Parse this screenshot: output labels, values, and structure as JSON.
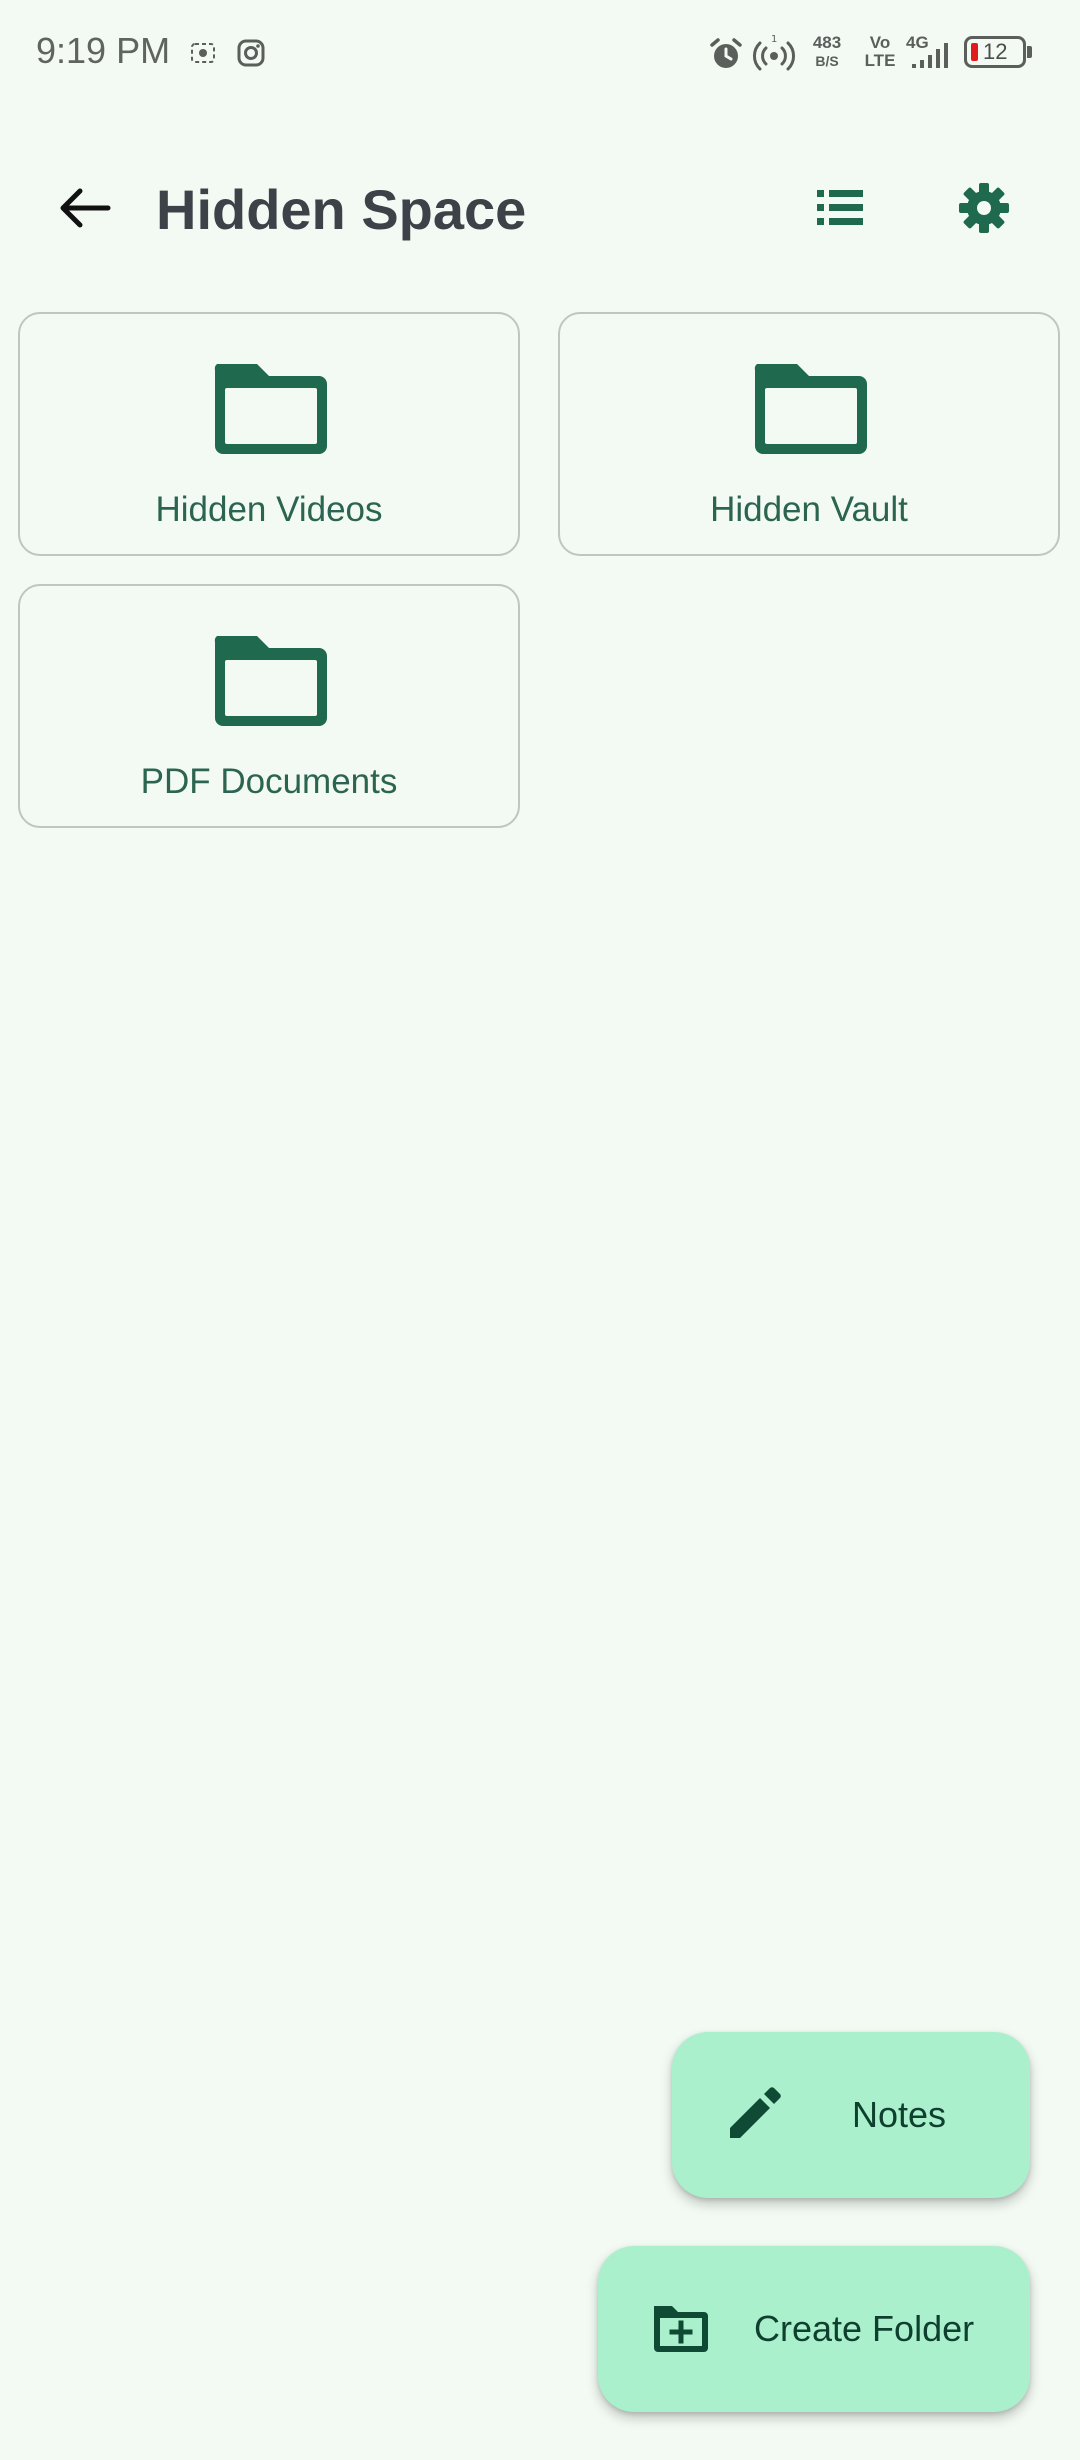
{
  "status_bar": {
    "time": "9:19 PM",
    "network_speed_value": "483",
    "network_speed_unit": "B/S",
    "volte_top": "Vo",
    "volte_bottom": "LTE",
    "network_type": "4G",
    "battery_level": "12",
    "icons": [
      "screenshot-icon",
      "instagram-icon",
      "alarm-icon",
      "hotspot-icon",
      "signal-icon",
      "battery-icon"
    ]
  },
  "app_bar": {
    "title": "Hidden Space",
    "back_icon": "arrow-back-icon",
    "list_icon": "list-view-icon",
    "settings_icon": "gear-icon"
  },
  "folders": [
    {
      "label": "Hidden Videos",
      "icon": "folder-icon"
    },
    {
      "label": "Hidden Vault",
      "icon": "folder-icon"
    },
    {
      "label": "PDF Documents",
      "icon": "folder-icon"
    }
  ],
  "fabs": {
    "notes": {
      "label": "Notes",
      "icon": "pencil-icon"
    },
    "create_folder": {
      "label": "Create Folder",
      "icon": "create-folder-icon"
    }
  },
  "colors": {
    "background": "#f3faf3",
    "accent": "#1f6a4f",
    "fab_background": "#aaf0cc",
    "title_text": "#3d4148",
    "folder_label": "#2b6450",
    "card_border": "#bfc5c1",
    "battery_low": "#e01b1b"
  }
}
